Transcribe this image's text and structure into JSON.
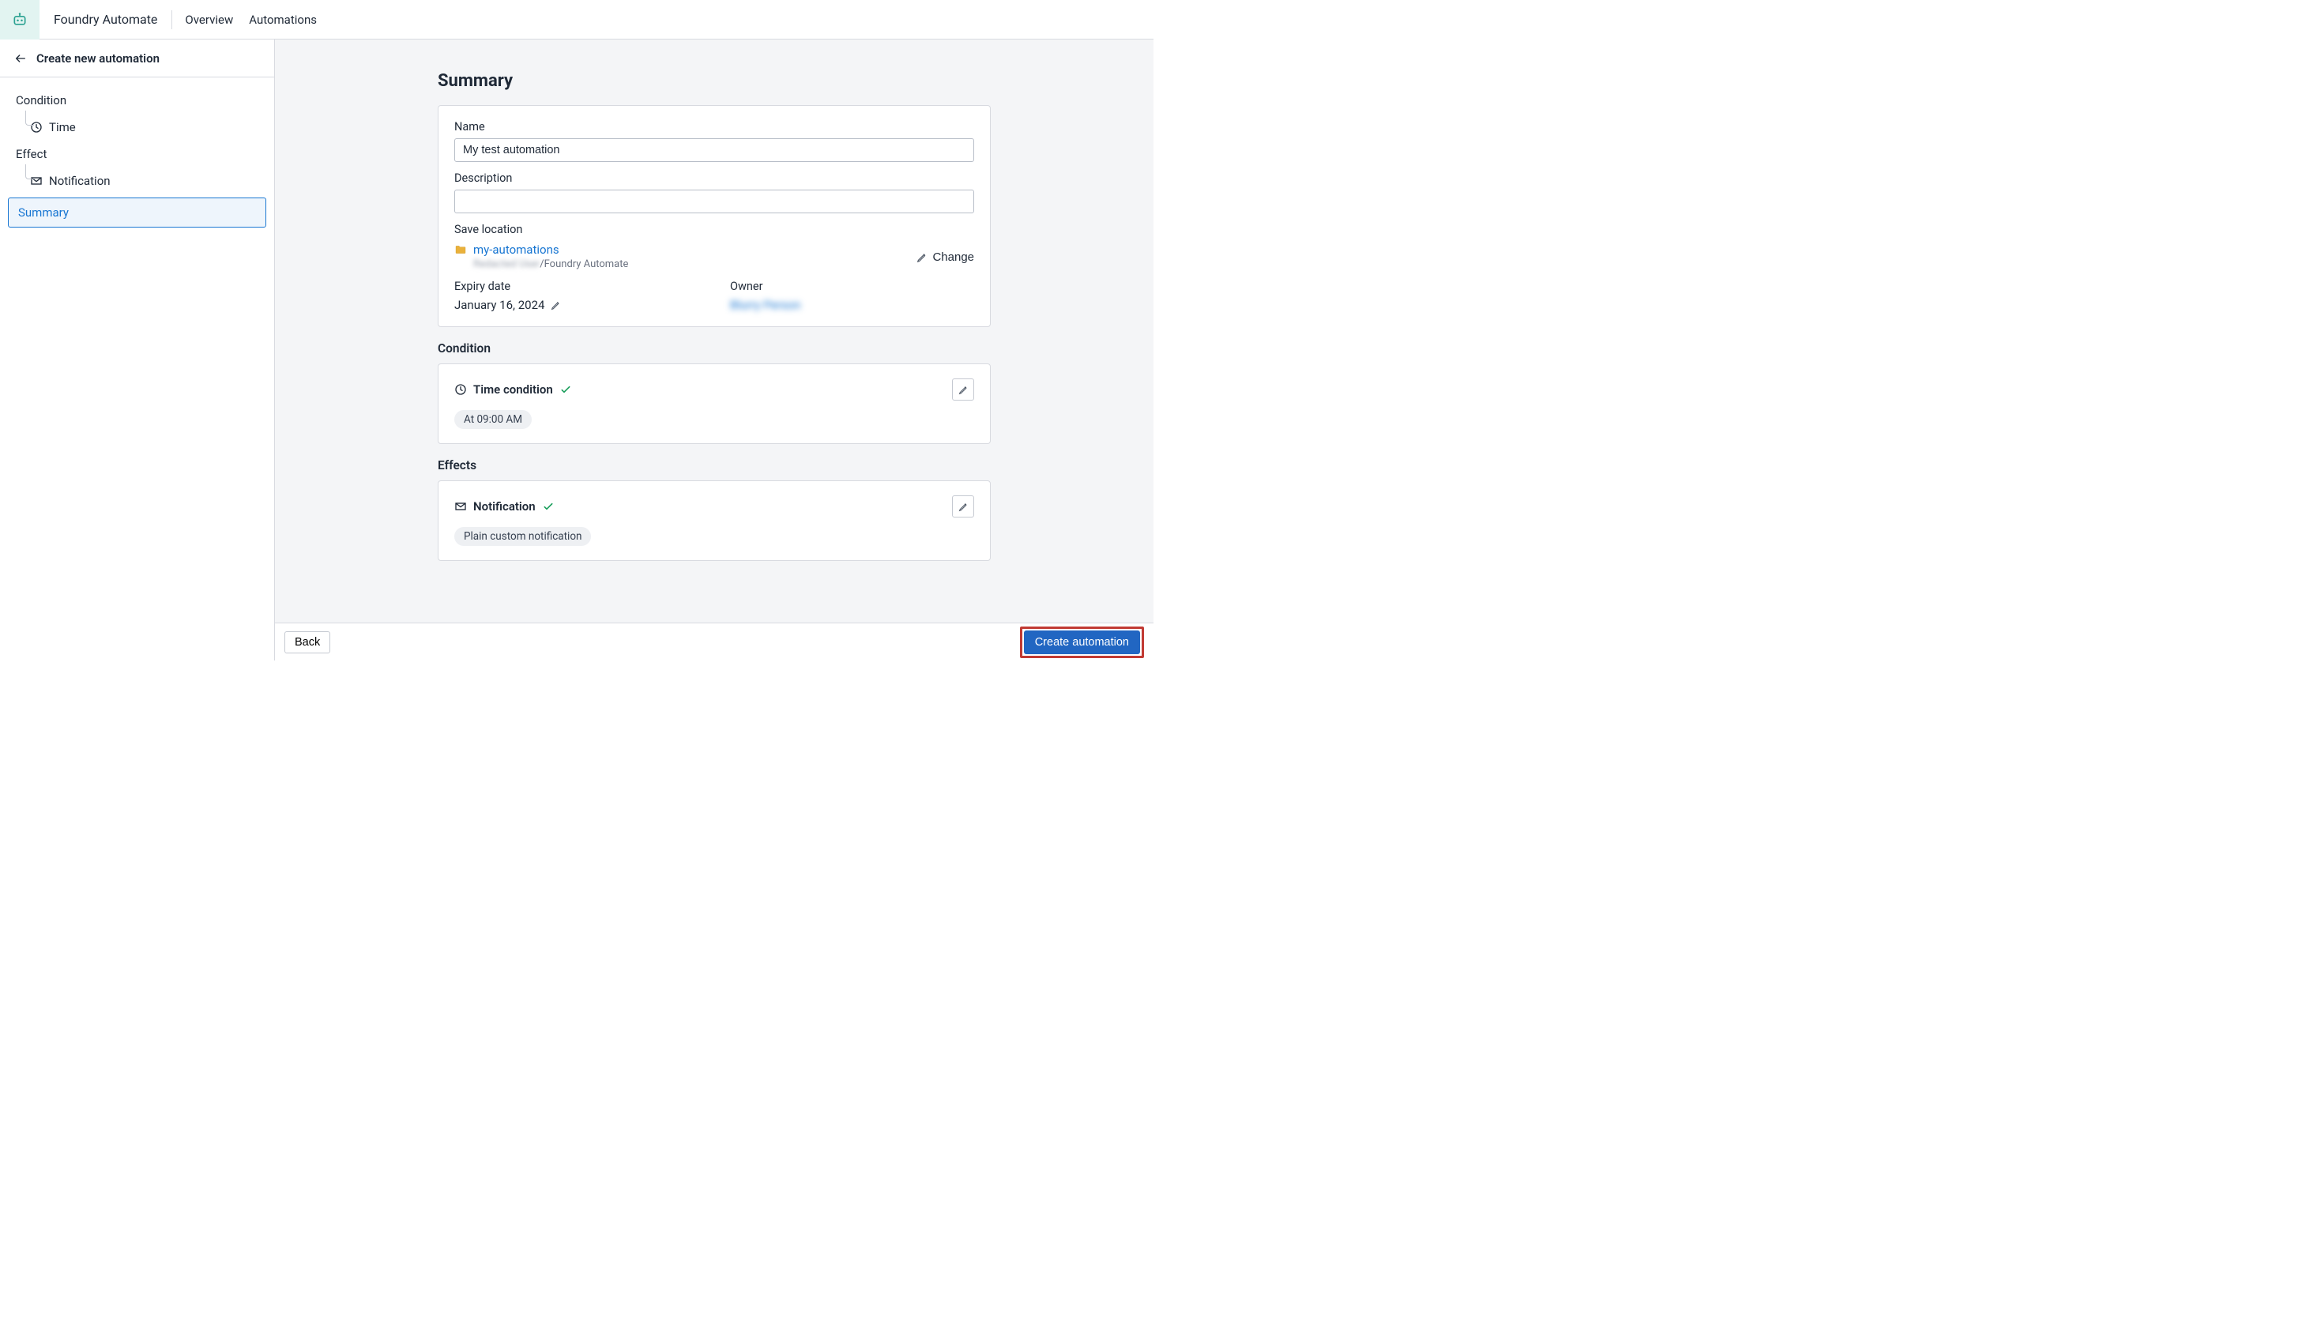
{
  "topbar": {
    "title": "Foundry Automate",
    "links": [
      "Overview",
      "Automations"
    ]
  },
  "sidebar": {
    "header_title": "Create new automation",
    "groups": [
      {
        "label": "Condition",
        "items": [
          {
            "icon": "clock",
            "label": "Time"
          }
        ]
      },
      {
        "label": "Effect",
        "items": [
          {
            "icon": "mail",
            "label": "Notification"
          }
        ]
      }
    ],
    "summary_label": "Summary"
  },
  "summary": {
    "heading": "Summary",
    "name_label": "Name",
    "name_value": "My test automation",
    "description_label": "Description",
    "description_value": "",
    "save_location_label": "Save location",
    "folder_name": "my-automations",
    "folder_path_redacted": "Redacted User",
    "folder_path_suffix": "/Foundry Automate",
    "change_label": "Change",
    "expiry_label": "Expiry date",
    "expiry_value": "January 16, 2024",
    "owner_label": "Owner",
    "owner_value": "Blurry Person"
  },
  "condition_section": {
    "heading": "Condition",
    "title": "Time condition",
    "chip": "At 09:00 AM"
  },
  "effects_section": {
    "heading": "Effects",
    "title": "Notification",
    "chip": "Plain custom notification"
  },
  "footer": {
    "back": "Back",
    "create": "Create automation"
  }
}
